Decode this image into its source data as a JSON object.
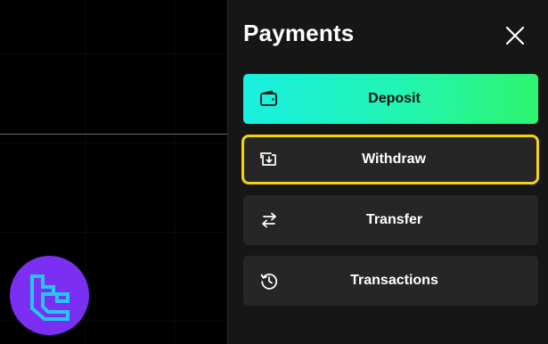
{
  "payments_panel": {
    "title": "Payments",
    "actions": [
      {
        "id": "deposit",
        "label": "Deposit",
        "icon": "wallet-icon"
      },
      {
        "id": "withdraw",
        "label": "Withdraw",
        "icon": "withdraw-icon",
        "highlighted": true
      },
      {
        "id": "transfer",
        "label": "Transfer",
        "icon": "transfer-arrows-icon"
      },
      {
        "id": "transactions",
        "label": "Transactions",
        "icon": "history-icon"
      }
    ],
    "close_icon": "close-icon"
  },
  "brand": {
    "logo_icon": "brand-logo-icon"
  },
  "colors": {
    "page_background": "#000000",
    "panel_background": "#161616",
    "button_background": "#262626",
    "deposit_gradient_start": "#19f0e0",
    "deposit_gradient_end": "#2ef46e",
    "highlight_border": "#f5d20b",
    "logo_background": "#7b2ff2",
    "logo_stroke": "#22c8f0"
  }
}
